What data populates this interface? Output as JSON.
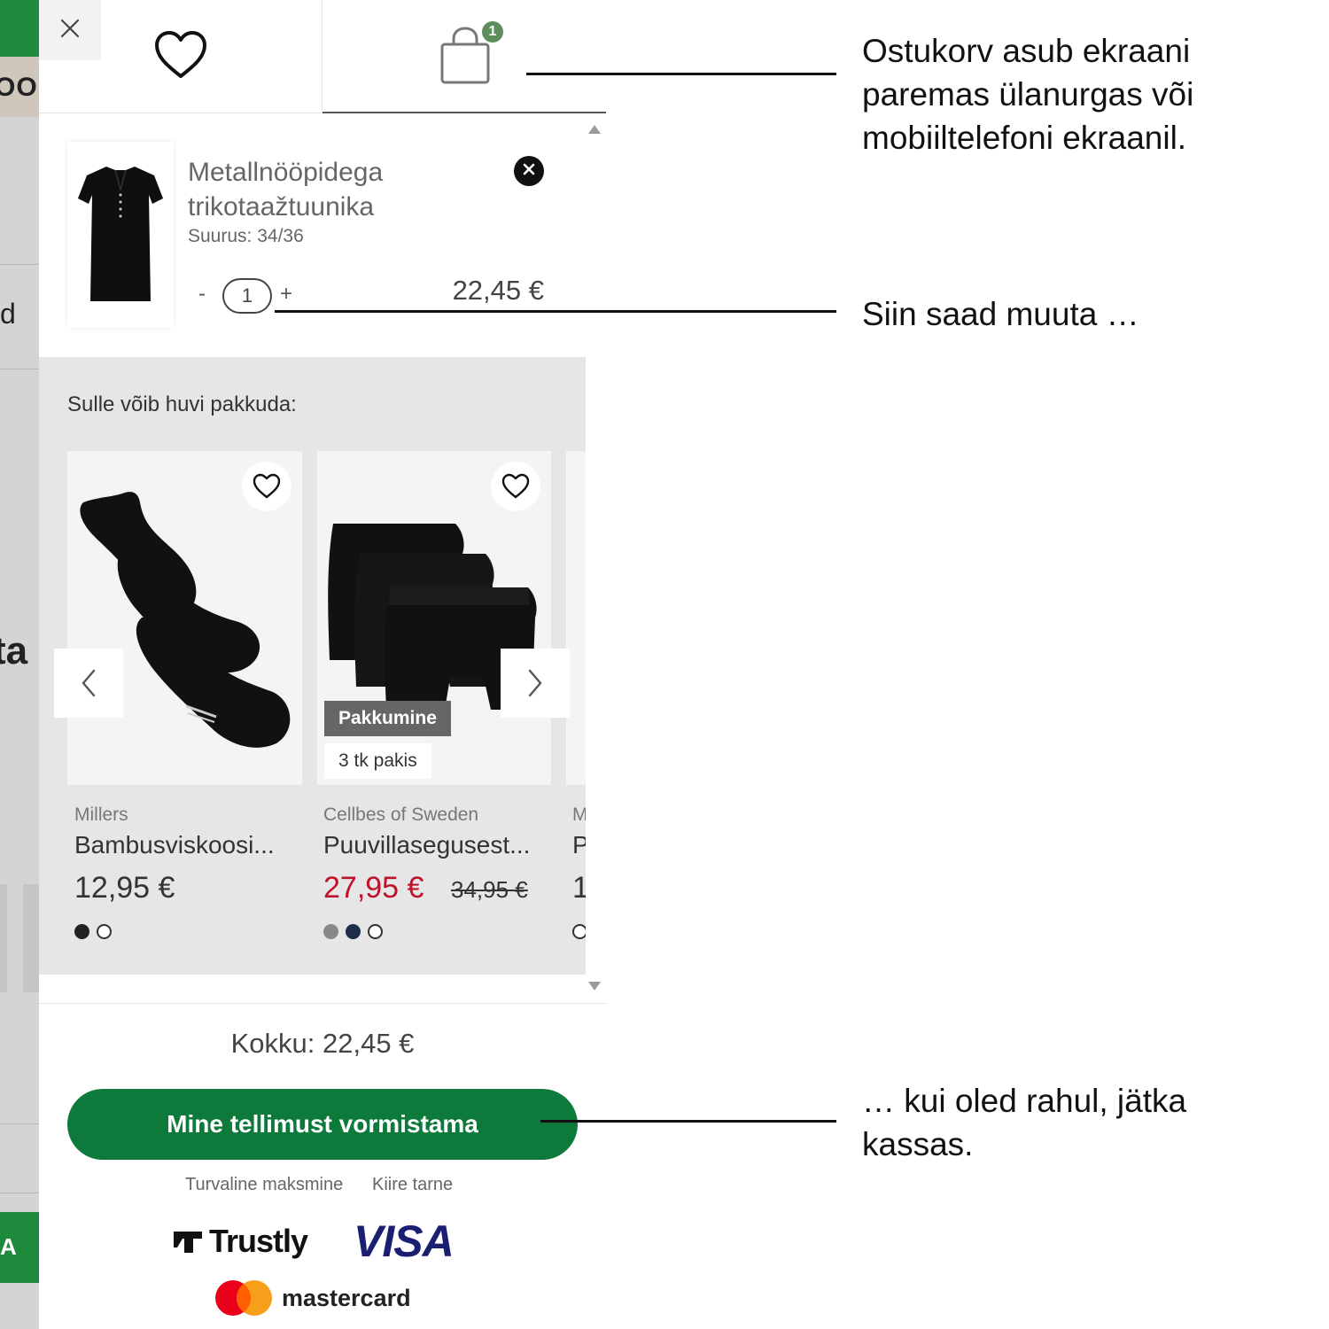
{
  "background": {
    "fragment_top": "OOD",
    "fragment_d": "d",
    "fragment_ta": "ta",
    "fragment_bottom": "A"
  },
  "header": {
    "cart_count": "1"
  },
  "cart_item": {
    "name_line1": "Metallnööpidega",
    "name_line2": "trikotaažtuunika",
    "size": "Suurus: 34/36",
    "qty_minus": "-",
    "quantity": "1",
    "qty_plus": "+",
    "price": "22,45 €"
  },
  "recommendations": {
    "title": "Sulle võib huvi pakkuda:",
    "products": [
      {
        "brand": "Millers",
        "name": "Bambusviskoosi...",
        "price": "12,95 €",
        "colors": [
          "#222222",
          "#ffffff"
        ]
      },
      {
        "brand": "Cellbes of Sweden",
        "name": "Puuvillasegusest...",
        "price": "27,95 €",
        "old_price": "34,95 €",
        "badge_offer": "Pakkumine",
        "badge_pack": "3 tk pakis",
        "colors": [
          "#888888",
          "#1f2d4a",
          "#ffffff"
        ]
      },
      {
        "brand": "M",
        "name": "P",
        "price": "1"
      }
    ]
  },
  "footer": {
    "total_label": "Kokku:",
    "total_value": "22,45 €",
    "checkout_label": "Mine tellimust vormistama",
    "trust_secure": "Turvaline maksmine",
    "trust_fast": "Kiire tarne",
    "logo_trustly": "Trustly",
    "logo_visa": "VISA",
    "logo_mastercard": "mastercard"
  },
  "annotations": {
    "cart_location": "Ostukorv asub ekraani paremas ülanurgas või mobiiltelefoni ekraanil.",
    "change_here": "Siin saad muuta …",
    "continue_checkout": "… kui oled rahul, jätka kassas."
  },
  "colors": {
    "brand_green": "#0d7a3c",
    "badge_green": "#5c8d5a",
    "sale_red": "#c0112b",
    "panel_grey": "#e6e6e6"
  },
  "icons": [
    "close-icon",
    "heart-icon",
    "shopping-bag-icon",
    "remove-icon",
    "chevron-left-icon",
    "chevron-right-icon"
  ]
}
